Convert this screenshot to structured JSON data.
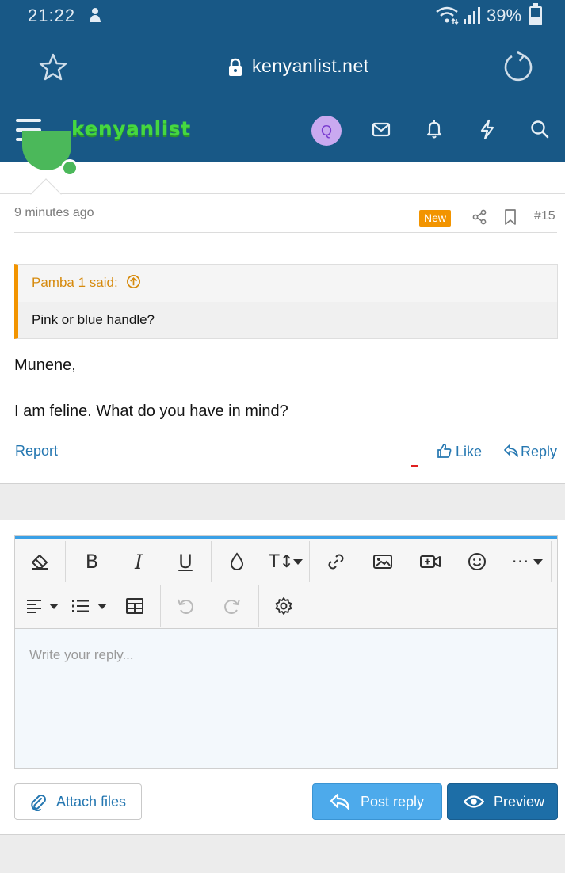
{
  "status_bar": {
    "time": "21:22",
    "battery": "39%"
  },
  "browser": {
    "url": "kenyanlist.net"
  },
  "site_header": {
    "logo": "kenyanlist",
    "avatar_letter": "Q"
  },
  "post": {
    "time_ago": "9 minutes ago",
    "new_badge": "New",
    "post_number": "#15",
    "quote": {
      "author": "Pamba 1 said:",
      "text": "Pink or blue handle?"
    },
    "message": [
      "Munene,",
      "I am feline. What do you have in mind?"
    ],
    "actions": {
      "report": "Report",
      "like": "Like",
      "reply": "Reply"
    }
  },
  "reply_editor": {
    "placeholder": "Write your reply...",
    "attach_label": "Attach files",
    "post_label": "Post reply",
    "preview_label": "Preview"
  },
  "colors": {
    "header_bg": "#185886",
    "accent_blue": "#2577b1",
    "badge_orange": "#f29400",
    "logo_green": "#45d840"
  }
}
